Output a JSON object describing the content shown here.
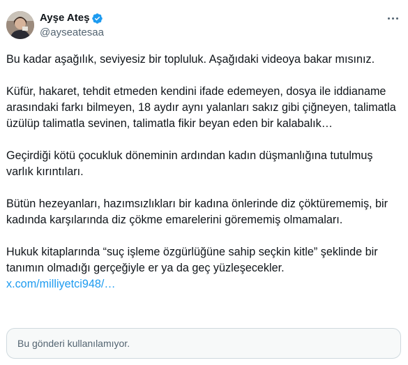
{
  "author": {
    "display_name": "Ayşe Ateş",
    "handle": "@ayseatesaa",
    "avatar_icon": "user-avatar",
    "verified_icon": "verified-badge-icon",
    "verified_color": "#1d9bf0"
  },
  "more_icon": "more-horizontal-icon",
  "post": {
    "paragraphs": [
      "Bu kadar aşağılık, seviyesiz bir topluluk. Aşağıdaki videoya bakar mısınız.",
      "Küfür, hakaret, tehdit etmeden kendini ifade edemeyen, dosya ile iddianame arasındaki farkı bilmeyen, 18 aydır aynı yalanları sakız gibi çiğneyen, talimatla üzülüp talimatla sevinen, talimatla fikir beyan eden bir kalabalık…",
      "Geçirdiği kötü çocukluk döneminin ardından kadın düşmanlığına tutulmuş varlık kırıntıları.",
      "Bütün hezeyanları, hazımsızlıkları bir kadına önlerinde diz çöktürememiş, bir kadında karşılarında diz çökme emarelerini görememiş olmamaları.",
      "Hukuk kitaplarında “suç işleme özgürlüğüne sahip seçkin kitle” şeklinde bir tanımın olmadığı gerçeğiyle er ya da geç yüzleşecekler."
    ],
    "link_text": "x.com/milliyetci948/…",
    "link_color": "#1d9bf0"
  },
  "quoted_post": {
    "unavailable_text": "Bu gönderi kullanılamıyor."
  }
}
